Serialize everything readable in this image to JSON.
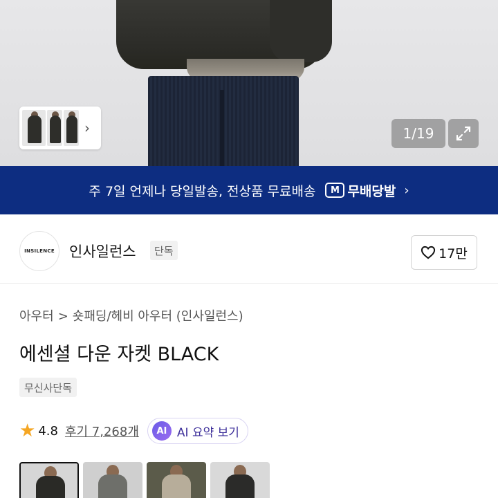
{
  "gallery": {
    "counter": "1/19",
    "thumbnail_strip_icon": "chevron-right-icon",
    "expand_icon": "expand-icon"
  },
  "banner": {
    "text": "주 7일 언제나 당일발송, 전상품 무료배송",
    "logo_mark": "M",
    "logo_text": "무배당발",
    "chevron": "›",
    "background_color": "#0d2d81"
  },
  "brand": {
    "logo_text": "INSILENCE",
    "name": "인사일런스",
    "tag": "단독",
    "like_count": "17만"
  },
  "product": {
    "breadcrumb": [
      "아우터",
      "숏패딩/헤비 아우터 (인사일런스)"
    ],
    "breadcrumb_separator": ">",
    "title": "에센셜 다운 자켓 BLACK",
    "exclusive_tag": "무신사단독",
    "rating": "4.8",
    "reviews": "후기 7,268개",
    "ai_badge": "AI",
    "ai_button": "AI 요약 보기",
    "star_color": "#f5a623"
  },
  "thumbnails": {
    "selected_index": 0,
    "count_visible": 4
  }
}
